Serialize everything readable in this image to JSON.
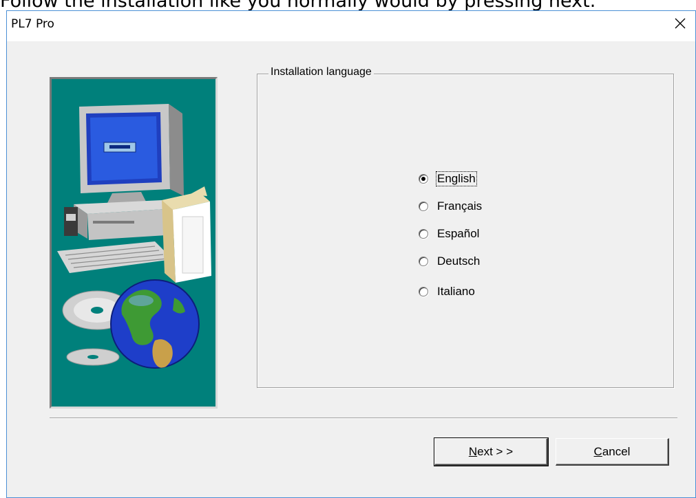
{
  "caption": {
    "text": "Follow the installation like you normally would by pressing next."
  },
  "window": {
    "title": "PL7 Pro",
    "close_glyph": "✕"
  },
  "language_group": {
    "label": "Installation language",
    "options": [
      {
        "label": "English",
        "checked": true
      },
      {
        "label": "Français",
        "checked": false
      },
      {
        "label": "Español",
        "checked": false
      },
      {
        "label": "Deutsch",
        "checked": false
      },
      {
        "label": "Italiano",
        "checked": false
      }
    ]
  },
  "buttons": {
    "next": {
      "mnemonic": "N",
      "rest": "ext > >"
    },
    "cancel": {
      "mnemonic": "C",
      "rest": "ancel"
    }
  },
  "colors": {
    "image_background": "#00807b",
    "dialog_face": "#f0f0f0",
    "window_border": "#4a8fd6"
  },
  "icons": {
    "side_image": "computer-cd-globe-illustration"
  }
}
